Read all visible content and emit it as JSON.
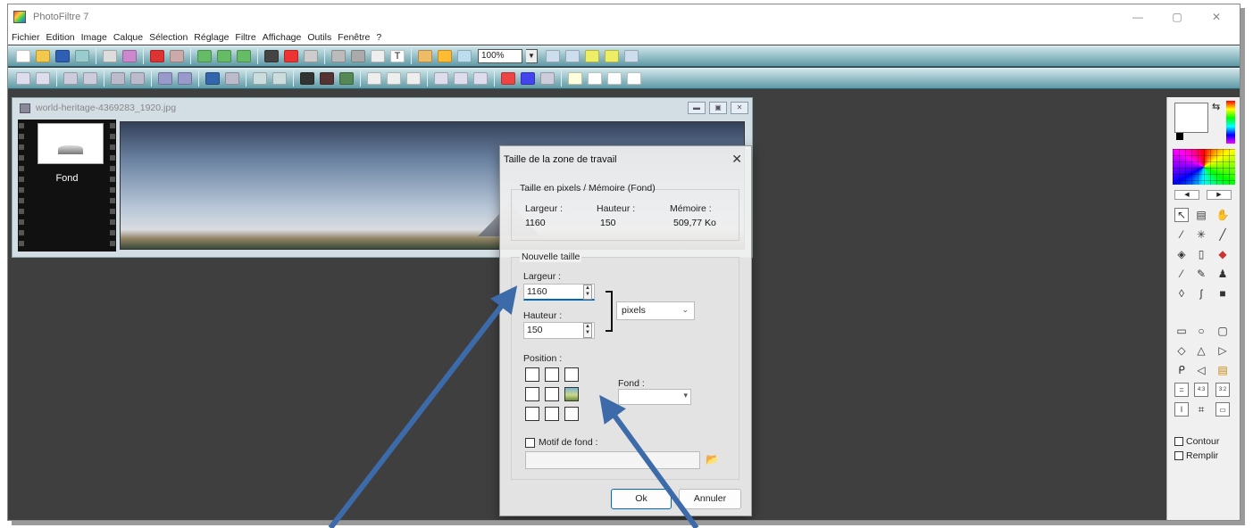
{
  "window": {
    "title": "PhotoFiltre 7",
    "controls": [
      "—",
      "▢",
      "✕"
    ]
  },
  "menu": [
    "Fichier",
    "Edition",
    "Image",
    "Calque",
    "Sélection",
    "Réglage",
    "Filtre",
    "Affichage",
    "Outils",
    "Fenêtre",
    "?"
  ],
  "toolbar": {
    "zoom_value": "100%"
  },
  "image_window": {
    "title": "world-heritage-4369283_1920.jpg",
    "layer_label": "Fond"
  },
  "dialog": {
    "title": "Taille de la zone de travail",
    "current_group_title": "Taille en pixels / Mémoire (Fond)",
    "current_width_label": "Largeur :",
    "current_height_label": "Hauteur :",
    "current_memory_label": "Mémoire :",
    "current_width": "1160",
    "current_height": "150",
    "current_memory": "509,77 Ko",
    "new_size_group_title": "Nouvelle taille",
    "new_width_label": "Largeur :",
    "new_width_value": "1160",
    "new_height_label": "Hauteur :",
    "new_height_value": "150",
    "unit_value": "pixels",
    "position_label": "Position :",
    "background_label": "Fond :",
    "background_value": "",
    "pattern_label": "Motif de fond :",
    "pattern_path": "",
    "ok_label": "Ok",
    "cancel_label": "Annuler"
  },
  "palette": {
    "contour_label": "Contour",
    "fill_label": "Remplir"
  }
}
